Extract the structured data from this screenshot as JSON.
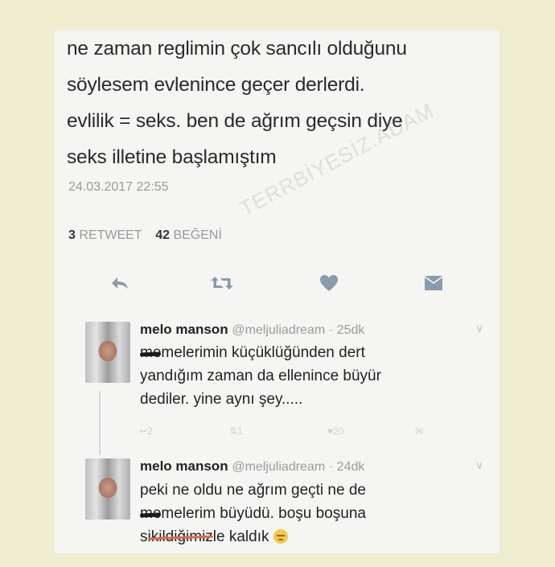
{
  "tweet": {
    "text_lines": [
      "ne zaman reglimin çok sancılı olduğunu",
      "söylesem evlenince geçer derlerdi.",
      "evlilik = seks. ben de ağrım geçsin diye",
      "seks illetine başlamıştım"
    ],
    "timestamp": "24.03.2017 22:55",
    "retweet_count": "3",
    "retweet_label": "RETWEET",
    "like_count": "42",
    "like_label": "BEĞENİ",
    "watermark": "TERRBİYESİZ.ADAM"
  },
  "actions": [
    "reply-icon",
    "retweet-icon",
    "heart-icon",
    "dm-icon"
  ],
  "replies": [
    {
      "name": "melo manson",
      "handle": "@meljuliadream",
      "time": "· 25dk",
      "lines": [
        {
          "redacted": "me",
          "rest": "melerimin küçüklüğünden dert"
        },
        {
          "text": "yandığım zaman da ellenince büyür"
        },
        {
          "text": "dediler. yine aynı şey....."
        }
      ],
      "reply_count": "2",
      "retweet_count": "1",
      "like_count": "20"
    },
    {
      "name": "melo manson",
      "handle": "@meljuliadream",
      "time": "· 24dk",
      "lines": [
        {
          "text": "peki ne oldu ne ağrım geçti ne de"
        },
        {
          "redacted": "me",
          "rest": "melerim büyüdü. boşu boşuna"
        },
        {
          "prefix": "s",
          "redacted": "ikildiğimiz",
          "rest": "le kaldık"
        }
      ]
    }
  ],
  "colors": {
    "background": "#efedd0",
    "card": "#f5f5f3",
    "text": "#2a2a2a",
    "muted": "#9a9a9a",
    "icon": "#8a9bab"
  }
}
